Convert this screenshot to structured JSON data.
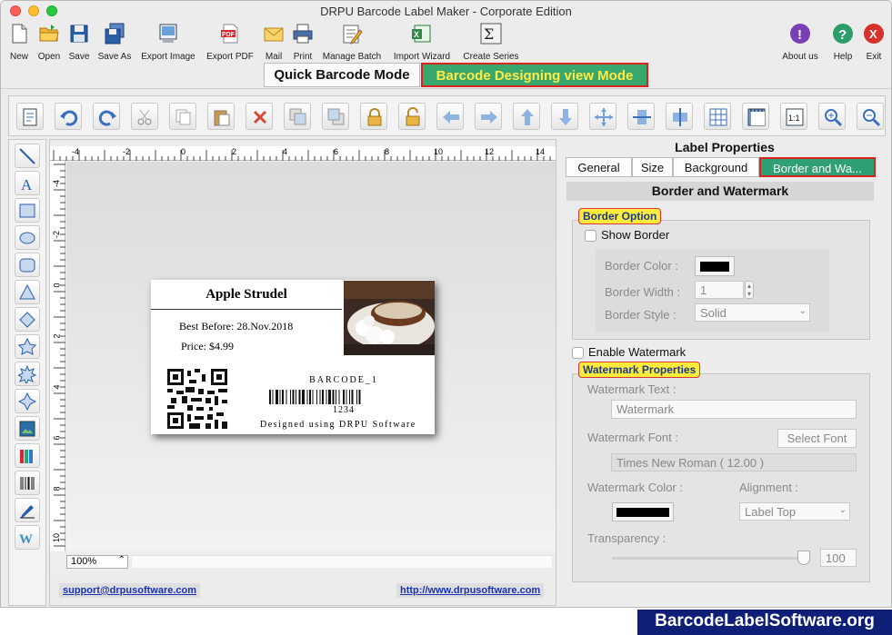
{
  "window": {
    "title": "DRPU Barcode Label Maker - Corporate Edition"
  },
  "main_toolbar": [
    {
      "label": "New",
      "icon": "new-file-icon"
    },
    {
      "label": "Open",
      "icon": "folder-open-icon"
    },
    {
      "label": "Save",
      "icon": "floppy-icon"
    },
    {
      "label": "Save As",
      "icon": "floppy-multi-icon"
    },
    {
      "label": "Export Image",
      "icon": "image-export-icon"
    },
    {
      "label": "Export PDF",
      "icon": "pdf-icon"
    },
    {
      "label": "Mail",
      "icon": "mail-icon"
    },
    {
      "label": "Print",
      "icon": "printer-icon"
    },
    {
      "label": "Manage Batch",
      "icon": "batch-icon"
    },
    {
      "label": "Import Wizard",
      "icon": "excel-import-icon"
    },
    {
      "label": "Create Series",
      "icon": "sigma-icon"
    }
  ],
  "help_toolbar": [
    {
      "label": "About us",
      "icon": "info-icon",
      "color": "#7b3fb5",
      "glyph": "!"
    },
    {
      "label": "Help",
      "icon": "help-icon",
      "color": "#2e9c6a",
      "glyph": "?"
    },
    {
      "label": "Exit",
      "icon": "exit-icon",
      "color": "#d6322b",
      "glyph": "X"
    }
  ],
  "modes": {
    "quick": "Quick Barcode Mode",
    "designing": "Barcode Designing view Mode"
  },
  "canvas": {
    "zoom": "100%",
    "ruler_top": [
      "-4",
      "-2",
      "0",
      "2",
      "4",
      "6",
      "8",
      "10",
      "12",
      "14"
    ],
    "ruler_left": [
      "-4",
      "-2",
      "0",
      "2",
      "4",
      "6",
      "8",
      "10"
    ]
  },
  "label": {
    "title": "Apple Strudel",
    "best_before": "Best Before: 28.Nov.2018",
    "price": "Price: $4.99",
    "barcode_name": "BARCODE_1",
    "barcode_value": "1234",
    "designed": "Designed using DRPU Software"
  },
  "links": {
    "support": "support@drpusoftware.com",
    "website": "http://www.drpusoftware.com"
  },
  "panel": {
    "title": "Label Properties",
    "tabs": [
      "General",
      "Size",
      "Background",
      "Border and Wa..."
    ],
    "section": "Border and Watermark",
    "border_option": "Border Option",
    "show_border": "Show Border",
    "border_color_label": "Border Color :",
    "border_width_label": "Border Width :",
    "border_width_value": "1",
    "border_style_label": "Border Style :",
    "border_style_value": "Solid",
    "enable_watermark": "Enable Watermark",
    "watermark_props": "Watermark Properties",
    "watermark_text_label": "Watermark Text :",
    "watermark_text_value": "Watermark",
    "watermark_font_label": "Watermark Font :",
    "select_font": "Select Font",
    "font_value": "Times New Roman ( 12.00 )",
    "watermark_color_label": "Watermark Color :",
    "alignment_label": "Alignment :",
    "alignment_value": "Label Top",
    "transparency_label": "Transparency :",
    "transparency_value": "100"
  },
  "brand": "BarcodeLabelSoftware.org",
  "colors": {
    "accent_green": "#2f9f74",
    "highlight_red": "#dd2222",
    "label_yellow": "#ffeb3b",
    "brand_blue": "#0f1f78"
  }
}
